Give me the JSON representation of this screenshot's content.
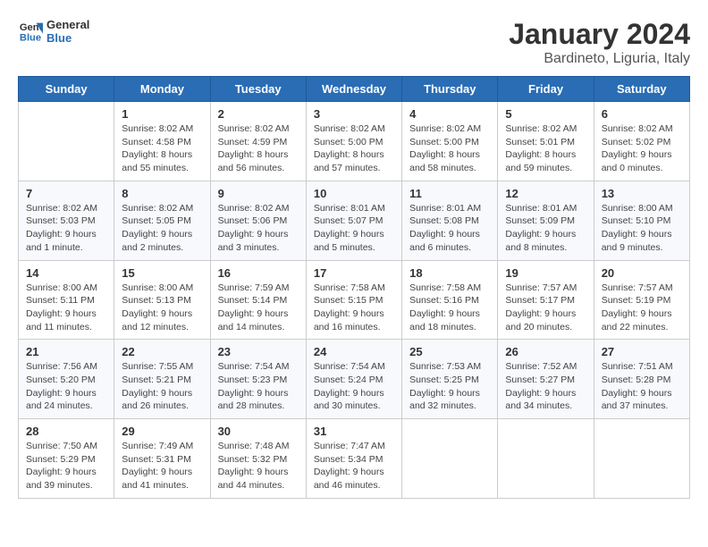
{
  "logo": {
    "line1": "General",
    "line2": "Blue"
  },
  "title": "January 2024",
  "subtitle": "Bardineto, Liguria, Italy",
  "headers": [
    "Sunday",
    "Monday",
    "Tuesday",
    "Wednesday",
    "Thursday",
    "Friday",
    "Saturday"
  ],
  "weeks": [
    [
      {
        "day": "",
        "info": ""
      },
      {
        "day": "1",
        "info": "Sunrise: 8:02 AM\nSunset: 4:58 PM\nDaylight: 8 hours\nand 55 minutes."
      },
      {
        "day": "2",
        "info": "Sunrise: 8:02 AM\nSunset: 4:59 PM\nDaylight: 8 hours\nand 56 minutes."
      },
      {
        "day": "3",
        "info": "Sunrise: 8:02 AM\nSunset: 5:00 PM\nDaylight: 8 hours\nand 57 minutes."
      },
      {
        "day": "4",
        "info": "Sunrise: 8:02 AM\nSunset: 5:00 PM\nDaylight: 8 hours\nand 58 minutes."
      },
      {
        "day": "5",
        "info": "Sunrise: 8:02 AM\nSunset: 5:01 PM\nDaylight: 8 hours\nand 59 minutes."
      },
      {
        "day": "6",
        "info": "Sunrise: 8:02 AM\nSunset: 5:02 PM\nDaylight: 9 hours\nand 0 minutes."
      }
    ],
    [
      {
        "day": "7",
        "info": "Sunrise: 8:02 AM\nSunset: 5:03 PM\nDaylight: 9 hours\nand 1 minute."
      },
      {
        "day": "8",
        "info": "Sunrise: 8:02 AM\nSunset: 5:05 PM\nDaylight: 9 hours\nand 2 minutes."
      },
      {
        "day": "9",
        "info": "Sunrise: 8:02 AM\nSunset: 5:06 PM\nDaylight: 9 hours\nand 3 minutes."
      },
      {
        "day": "10",
        "info": "Sunrise: 8:01 AM\nSunset: 5:07 PM\nDaylight: 9 hours\nand 5 minutes."
      },
      {
        "day": "11",
        "info": "Sunrise: 8:01 AM\nSunset: 5:08 PM\nDaylight: 9 hours\nand 6 minutes."
      },
      {
        "day": "12",
        "info": "Sunrise: 8:01 AM\nSunset: 5:09 PM\nDaylight: 9 hours\nand 8 minutes."
      },
      {
        "day": "13",
        "info": "Sunrise: 8:00 AM\nSunset: 5:10 PM\nDaylight: 9 hours\nand 9 minutes."
      }
    ],
    [
      {
        "day": "14",
        "info": "Sunrise: 8:00 AM\nSunset: 5:11 PM\nDaylight: 9 hours\nand 11 minutes."
      },
      {
        "day": "15",
        "info": "Sunrise: 8:00 AM\nSunset: 5:13 PM\nDaylight: 9 hours\nand 12 minutes."
      },
      {
        "day": "16",
        "info": "Sunrise: 7:59 AM\nSunset: 5:14 PM\nDaylight: 9 hours\nand 14 minutes."
      },
      {
        "day": "17",
        "info": "Sunrise: 7:58 AM\nSunset: 5:15 PM\nDaylight: 9 hours\nand 16 minutes."
      },
      {
        "day": "18",
        "info": "Sunrise: 7:58 AM\nSunset: 5:16 PM\nDaylight: 9 hours\nand 18 minutes."
      },
      {
        "day": "19",
        "info": "Sunrise: 7:57 AM\nSunset: 5:17 PM\nDaylight: 9 hours\nand 20 minutes."
      },
      {
        "day": "20",
        "info": "Sunrise: 7:57 AM\nSunset: 5:19 PM\nDaylight: 9 hours\nand 22 minutes."
      }
    ],
    [
      {
        "day": "21",
        "info": "Sunrise: 7:56 AM\nSunset: 5:20 PM\nDaylight: 9 hours\nand 24 minutes."
      },
      {
        "day": "22",
        "info": "Sunrise: 7:55 AM\nSunset: 5:21 PM\nDaylight: 9 hours\nand 26 minutes."
      },
      {
        "day": "23",
        "info": "Sunrise: 7:54 AM\nSunset: 5:23 PM\nDaylight: 9 hours\nand 28 minutes."
      },
      {
        "day": "24",
        "info": "Sunrise: 7:54 AM\nSunset: 5:24 PM\nDaylight: 9 hours\nand 30 minutes."
      },
      {
        "day": "25",
        "info": "Sunrise: 7:53 AM\nSunset: 5:25 PM\nDaylight: 9 hours\nand 32 minutes."
      },
      {
        "day": "26",
        "info": "Sunrise: 7:52 AM\nSunset: 5:27 PM\nDaylight: 9 hours\nand 34 minutes."
      },
      {
        "day": "27",
        "info": "Sunrise: 7:51 AM\nSunset: 5:28 PM\nDaylight: 9 hours\nand 37 minutes."
      }
    ],
    [
      {
        "day": "28",
        "info": "Sunrise: 7:50 AM\nSunset: 5:29 PM\nDaylight: 9 hours\nand 39 minutes."
      },
      {
        "day": "29",
        "info": "Sunrise: 7:49 AM\nSunset: 5:31 PM\nDaylight: 9 hours\nand 41 minutes."
      },
      {
        "day": "30",
        "info": "Sunrise: 7:48 AM\nSunset: 5:32 PM\nDaylight: 9 hours\nand 44 minutes."
      },
      {
        "day": "31",
        "info": "Sunrise: 7:47 AM\nSunset: 5:34 PM\nDaylight: 9 hours\nand 46 minutes."
      },
      {
        "day": "",
        "info": ""
      },
      {
        "day": "",
        "info": ""
      },
      {
        "day": "",
        "info": ""
      }
    ]
  ]
}
